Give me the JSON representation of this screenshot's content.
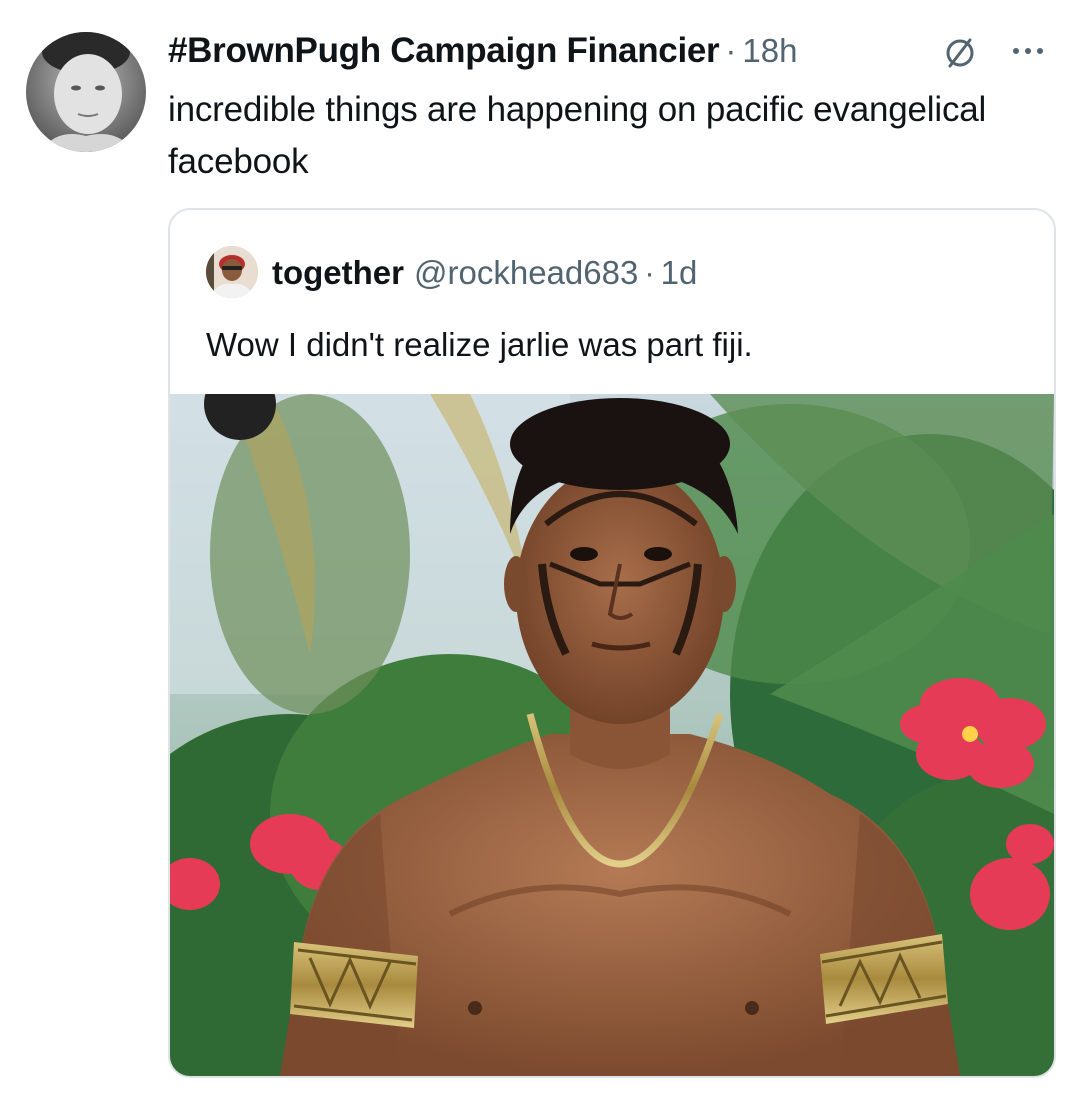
{
  "tweet": {
    "display_name": "#BrownPugh Campaign Financier",
    "separator": "·",
    "time": "18h",
    "text": "incredible things are happening on pacific evangelical facebook",
    "avatar_icon": "profile-photo",
    "badge_icon": "circle-slash-icon",
    "more_icon": "ellipsis-icon"
  },
  "quote": {
    "display_name": "together",
    "handle": "@rockhead683",
    "separator": "·",
    "time": "1d",
    "text": "Wow I didn't realize jarlie was part fiji.",
    "avatar_icon": "profile-photo",
    "media_icon": "photo"
  },
  "colors": {
    "text_primary": "#0f1419",
    "text_secondary": "#536471",
    "border": "#dfe3e6",
    "background": "#ffffff"
  }
}
